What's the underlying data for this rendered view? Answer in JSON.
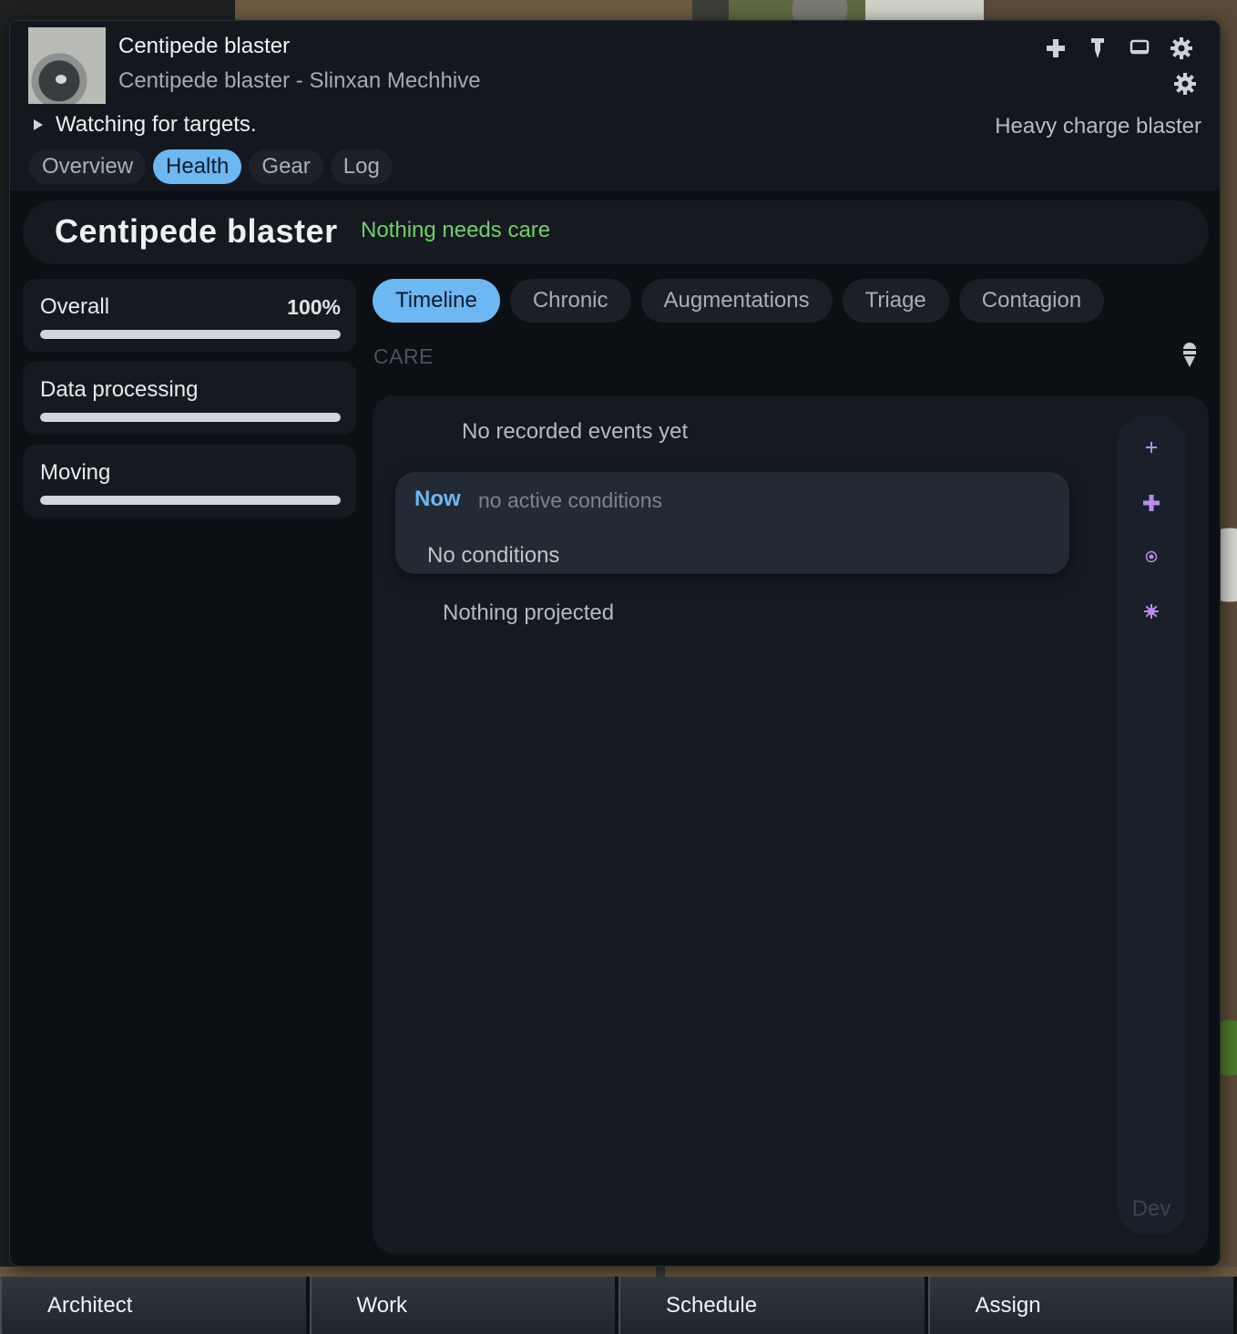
{
  "header": {
    "title": "Centipede blaster",
    "subtitle": "Centipede blaster - Slinxan Mechhive",
    "status": "Watching for targets.",
    "weapon": "Heavy charge blaster",
    "icons": [
      "medical-cross-icon",
      "pin-icon",
      "monitor-icon",
      "gear-icon",
      "settings-icon"
    ]
  },
  "tabs": [
    {
      "label": "Overview",
      "active": false
    },
    {
      "label": "Health",
      "active": true
    },
    {
      "label": "Gear",
      "active": false
    },
    {
      "label": "Log",
      "active": false
    }
  ],
  "health": {
    "name": "Centipede blaster",
    "status": "Nothing needs care",
    "status_color": "#6fd06a"
  },
  "capacities": [
    {
      "label": "Overall",
      "value": "100%",
      "level": 1.0
    },
    {
      "label": "Data processing",
      "value": "",
      "level": 1.0
    },
    {
      "label": "Moving",
      "value": "",
      "level": 1.0
    }
  ],
  "subtabs": [
    {
      "label": "Timeline",
      "active": true
    },
    {
      "label": "Chronic",
      "active": false
    },
    {
      "label": "Augmentations",
      "active": false
    },
    {
      "label": "Triage",
      "active": false
    },
    {
      "label": "Contagion",
      "active": false
    }
  ],
  "care_label": "CARE",
  "timeline": {
    "no_events": "No recorded events yet",
    "now_label": "Now",
    "now_text": "no active conditions",
    "no_conditions": "No conditions",
    "nothing_projected": "Nothing projected",
    "dev": "Dev",
    "rail_icons": [
      "small-plus-icon",
      "plus-icon",
      "target-dot-icon",
      "burst-icon"
    ]
  },
  "bottombar": [
    "Architect",
    "Work",
    "Schedule",
    "Assign"
  ],
  "colors": {
    "accent": "#6db7f2",
    "ok": "#6fd06a",
    "rail_icon": "#b98bf0"
  }
}
